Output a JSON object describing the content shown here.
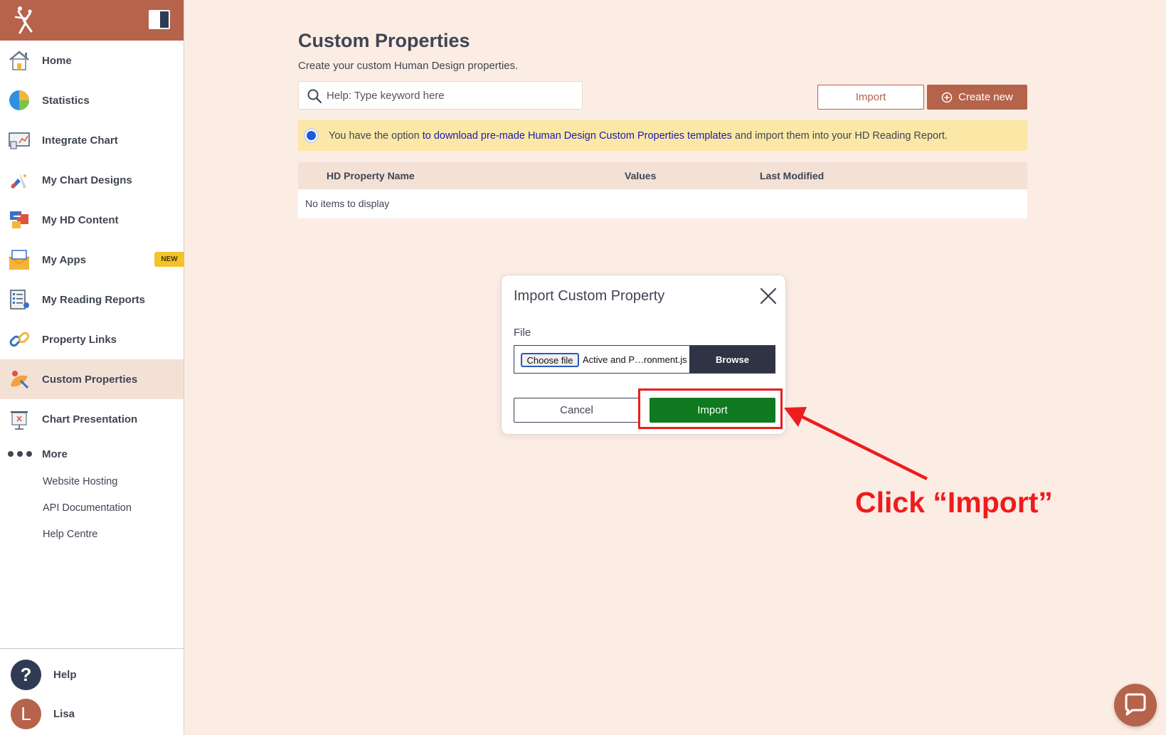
{
  "sidebar": {
    "items": [
      {
        "label": "Home"
      },
      {
        "label": "Statistics"
      },
      {
        "label": "Integrate Chart"
      },
      {
        "label": "My Chart Designs"
      },
      {
        "label": "My HD Content"
      },
      {
        "label": "My Apps"
      },
      {
        "label": "My Reading Reports"
      },
      {
        "label": "Property Links"
      },
      {
        "label": "Custom Properties"
      },
      {
        "label": "Chart Presentation"
      }
    ],
    "new_badge": "NEW",
    "more_label": "More",
    "sub_items": [
      {
        "label": "Website Hosting"
      },
      {
        "label": "API Documentation"
      },
      {
        "label": "Help Centre"
      }
    ],
    "help_label": "Help",
    "help_glyph": "?",
    "user_name": "Lisa",
    "user_initial": "L"
  },
  "main": {
    "title": "Custom Properties",
    "subtitle": "Create your custom Human Design properties.",
    "search_placeholder": "Help: Type keyword here",
    "import_label": "Import",
    "create_label": "Create new",
    "info": {
      "prefix": "You have the option ",
      "link": "to download pre-made Human Design Custom Properties templates",
      "suffix": " and import them into your HD Reading Report."
    },
    "table": {
      "columns": [
        "HD Property Name",
        "Values",
        "Last Modified"
      ],
      "empty_text": "No items to display"
    }
  },
  "modal": {
    "title": "Import Custom Property",
    "file_label": "File",
    "choose_file_label": "Choose file",
    "file_name": "Active and P…ronment.js",
    "browse_label": "Browse",
    "cancel_label": "Cancel",
    "import_label": "Import"
  },
  "annotation": {
    "text": "Click “Import”"
  },
  "colors": {
    "brand": "#b5634a",
    "background": "#fbece4",
    "info_bar": "#fbe8a6",
    "import_green": "#0f7a1f",
    "annotation_red": "#ee1c1c"
  }
}
